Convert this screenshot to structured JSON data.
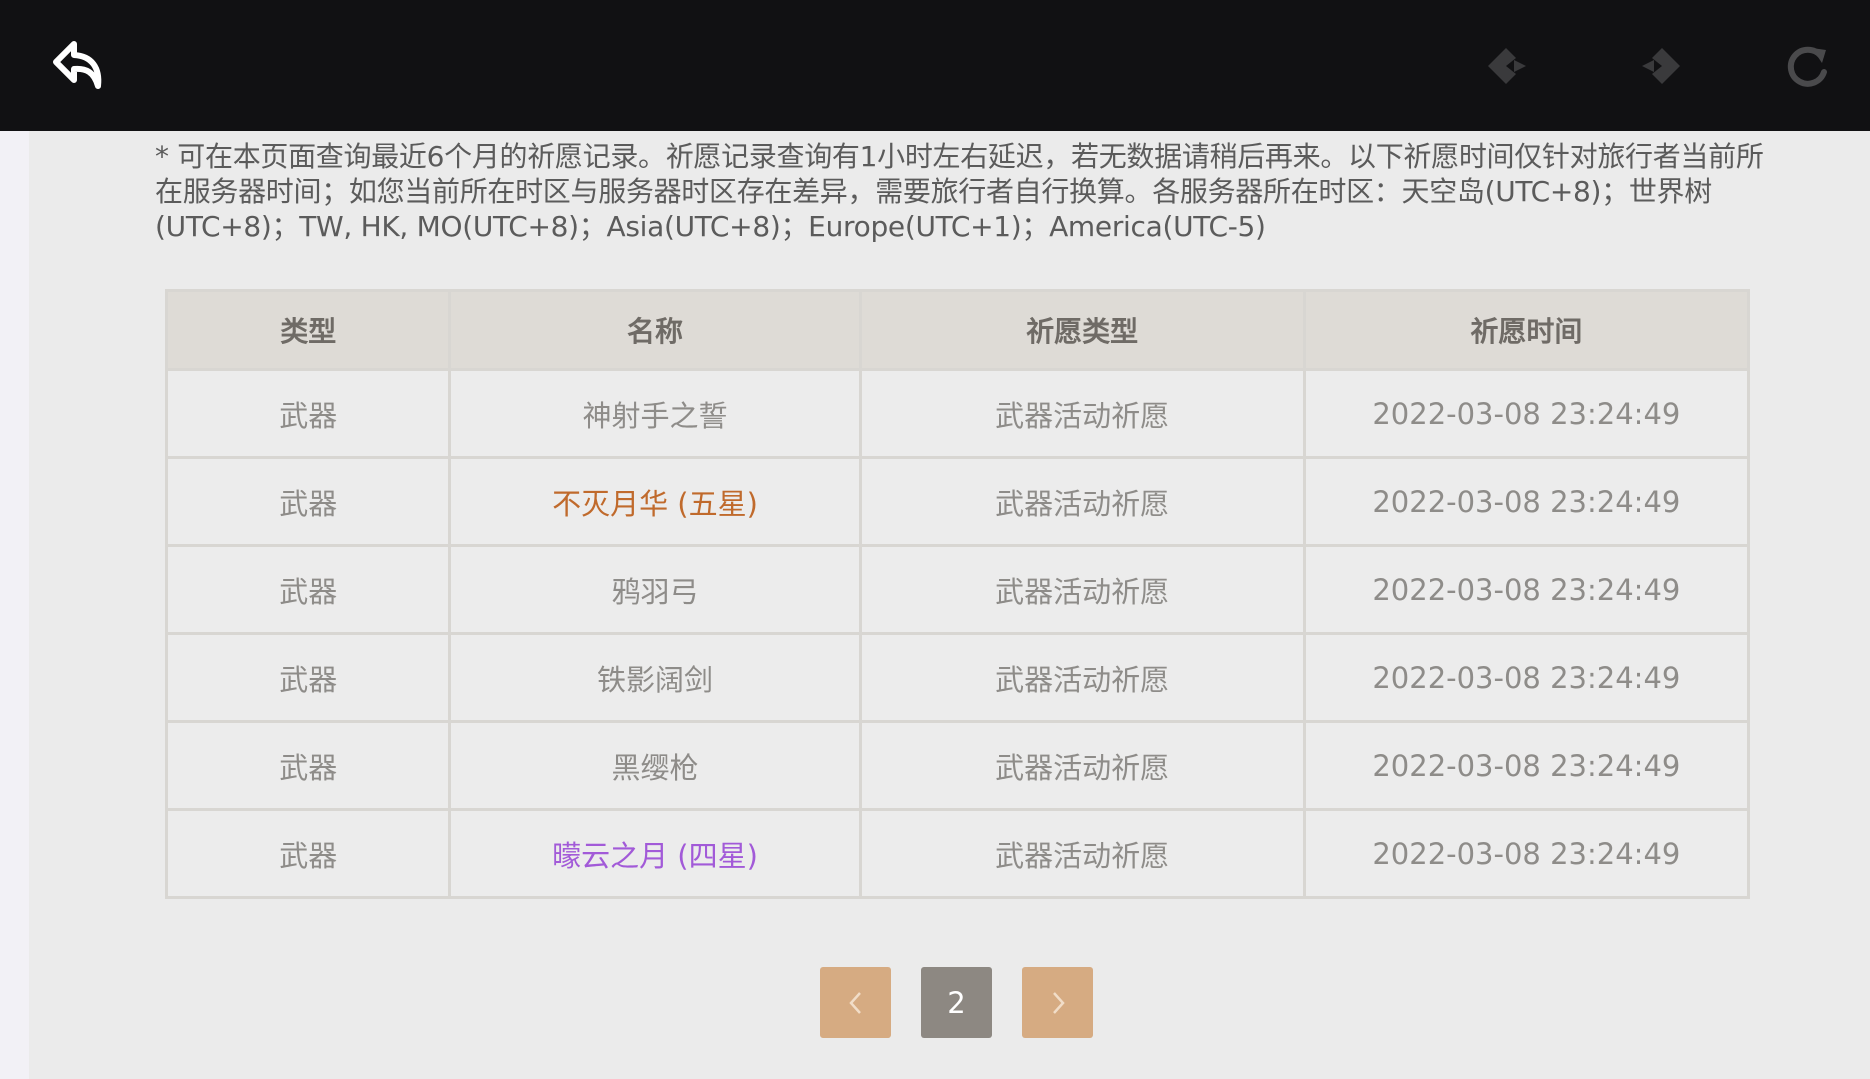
{
  "icons": {
    "back": "back-arrow-icon",
    "history_back": "diamond-left-icon",
    "history_forward": "diamond-right-icon",
    "refresh": "refresh-icon"
  },
  "notice": "* 可在本页面查询最近6个月的祈愿记录。祈愿记录查询有1小时左右延迟，若无数据请稍后再来。以下祈愿时间仅针对旅行者当前所在服务器时间；如您当前所在时区与服务器时区存在差异，需要旅行者自行换算。各服务器所在时区：天空岛(UTC+8)；世界树(UTC+8)；TW, HK, MO(UTC+8)；Asia(UTC+8)；Europe(UTC+1)；America(UTC-5)",
  "table": {
    "headers": [
      "类型",
      "名称",
      "祈愿类型",
      "祈愿时间"
    ],
    "rows": [
      {
        "type": "武器",
        "name": "神射手之誓",
        "wish": "武器活动祈愿",
        "time": "2022-03-08 23:24:49",
        "rarity": "3"
      },
      {
        "type": "武器",
        "name": "不灭月华 (五星)",
        "wish": "武器活动祈愿",
        "time": "2022-03-08 23:24:49",
        "rarity": "5"
      },
      {
        "type": "武器",
        "name": "鸦羽弓",
        "wish": "武器活动祈愿",
        "time": "2022-03-08 23:24:49",
        "rarity": "3"
      },
      {
        "type": "武器",
        "name": "铁影阔剑",
        "wish": "武器活动祈愿",
        "time": "2022-03-08 23:24:49",
        "rarity": "3"
      },
      {
        "type": "武器",
        "name": "黑缨枪",
        "wish": "武器活动祈愿",
        "time": "2022-03-08 23:24:49",
        "rarity": "3"
      },
      {
        "type": "武器",
        "name": "曚云之月 (四星)",
        "wish": "武器活动祈愿",
        "time": "2022-03-08 23:24:49",
        "rarity": "4"
      }
    ]
  },
  "colors": {
    "five_star": "#c06a2c",
    "four_star": "#a25ad8",
    "pager_button": "#d6ab82",
    "pager_current": "#8d8882"
  },
  "pagination": {
    "current_page": "2"
  }
}
